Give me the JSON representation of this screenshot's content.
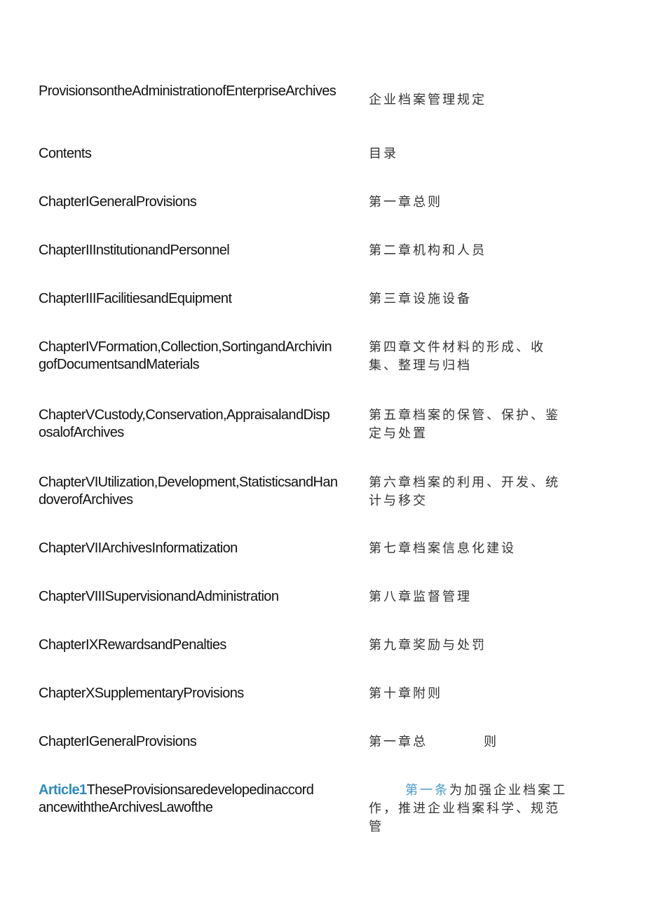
{
  "document": {
    "title_en": "ProvisionsontheAdministrationofEnterpriseArchives",
    "title_zh": "企业档案管理规定",
    "contents_en": "Contents",
    "contents_zh": "目录",
    "toc": [
      {
        "en": "ChapterIGeneralProvisions",
        "zh": "第一章总则"
      },
      {
        "en": "ChapterIIInstitutionandPersonnel",
        "zh": "第二章机构和人员"
      },
      {
        "en": "ChapterIIIFacilitiesandEquipment",
        "zh": "第三章设施设备"
      },
      {
        "en": "ChapterIVFormation,Collection,SortingandArchivingofDocumentsandMaterials",
        "zh": "第四章文件材料的形成、收集、整理与归档"
      },
      {
        "en": "ChapterVCustody,Conservation,AppraisalandDisposalofArchives",
        "zh": "第五章档案的保管、保护、鉴定与处置"
      },
      {
        "en": "ChapterVIUtilization,Development,StatisticsandHandoverofArchives",
        "zh": "第六章档案的利用、开发、统计与移交"
      },
      {
        "en": "ChapterVIIArchivesInformatization",
        "zh": "第七章档案信息化建设"
      },
      {
        "en": "ChapterVIIISupervisionandAdministration",
        "zh": "第八章监督管理"
      },
      {
        "en": "ChapterIXRewardsandPenalties",
        "zh": "第九章奖励与处罚"
      },
      {
        "en": "ChapterXSupplementaryProvisions",
        "zh": "第十章附则"
      }
    ],
    "chapter_heading": {
      "en": "ChapterIGeneralProvisions",
      "zh_part1": "第一章总",
      "zh_part2": "则"
    },
    "article1": {
      "label_en": "Article1",
      "text_en": "TheseProvisionsaredevelopedinaccordancewiththeArchivesLawofthe",
      "label_zh": "第一条",
      "text_zh": "为加强企业档案工作，推进企业档案科学、规范管"
    },
    "colors": {
      "accent_en": "#2f8bc0",
      "accent_zh": "#4a9ac9",
      "text": "#111111"
    }
  }
}
